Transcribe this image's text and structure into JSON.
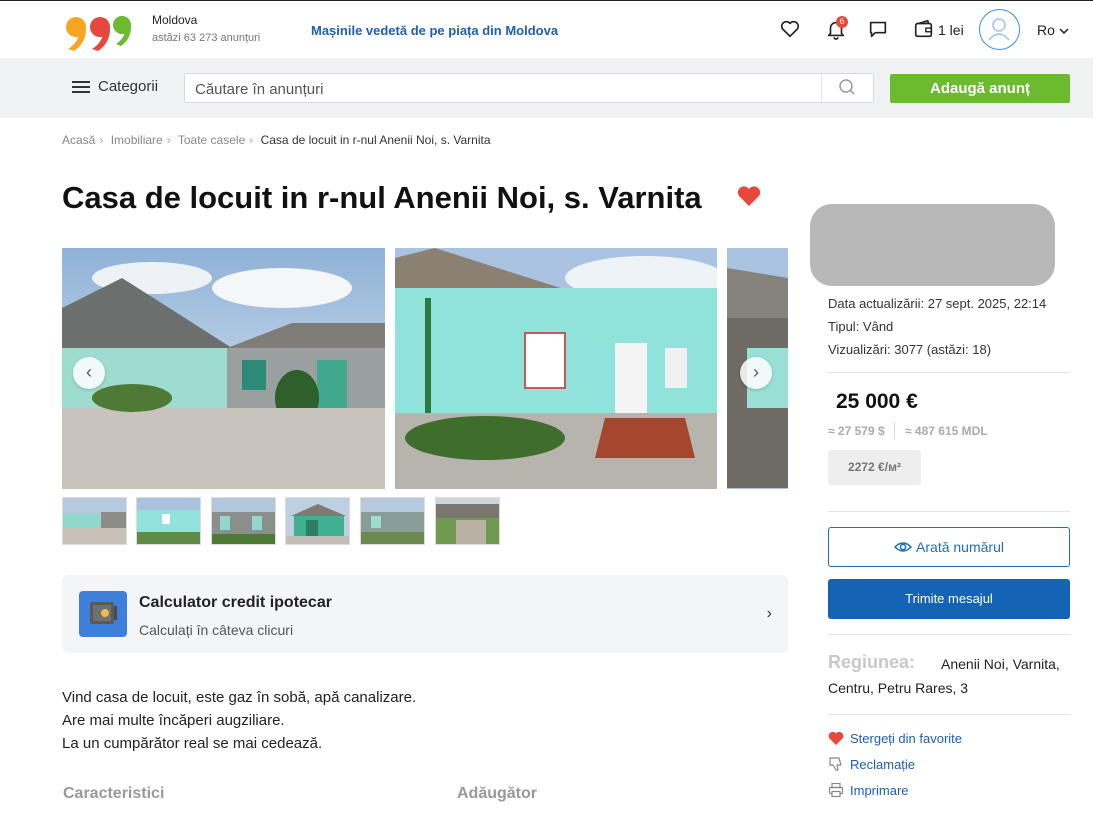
{
  "header": {
    "region": "Moldova",
    "listings_today": "astăzi 63 273 anunțuri",
    "promo": "Mașinile vedetă de pe piața din Moldova",
    "notifications_count": "6",
    "wallet": "1 lei",
    "language": "Ro"
  },
  "toolbar": {
    "categories_label": "Categorii",
    "search_placeholder": "Căutare în anunțuri",
    "add_label": "Adaugă anunț"
  },
  "breadcrumbs": [
    "Acasă",
    "Imobiliare",
    "Toate casele",
    "Casa de locuit in r-nul Anenii Noi, s. Varnita"
  ],
  "listing": {
    "title": "Casa de locuit in r-nul Anenii Noi, s. Varnita",
    "favorite_color": "#e8473b"
  },
  "calculator": {
    "title": "Calculator credit ipotecar",
    "subtitle": "Calculați în câteva clicuri"
  },
  "description": [
    "Vind casa de locuit, este gaz în sobă, apă canalizare.",
    "Are mai multe încăperi augziliare.",
    "La un cumpărător real se mai cedează."
  ],
  "sections": {
    "characteristics": "Caracteristici",
    "additional": "Adăugător"
  },
  "sidebar": {
    "updated": "Data actualizării: 27 sept. 2025, 22:14",
    "type": "Tipul: Vând",
    "views": "Vizualizări: 3077 (astăzi: 18)",
    "price": "25 000 €",
    "price_usd": "≈ 27 579 $",
    "price_mdl": "≈ 487 615 MDL",
    "price_per_m2": "2272 €/м²",
    "show_number": "Arată numărul",
    "send_message": "Trimite mesajul",
    "region_label": "Regiunea:",
    "region_value_1": "Anenii Noi, Varnita,",
    "region_value_2": "Centru, Petru Rares, 3",
    "remove_favorite": "Stergeți din favorite",
    "report": "Reclamație",
    "print": "Imprimare"
  },
  "colors": {
    "accent_blue": "#1463b5",
    "add_green": "#6cbb2e",
    "link_blue": "#1d5fb5"
  }
}
